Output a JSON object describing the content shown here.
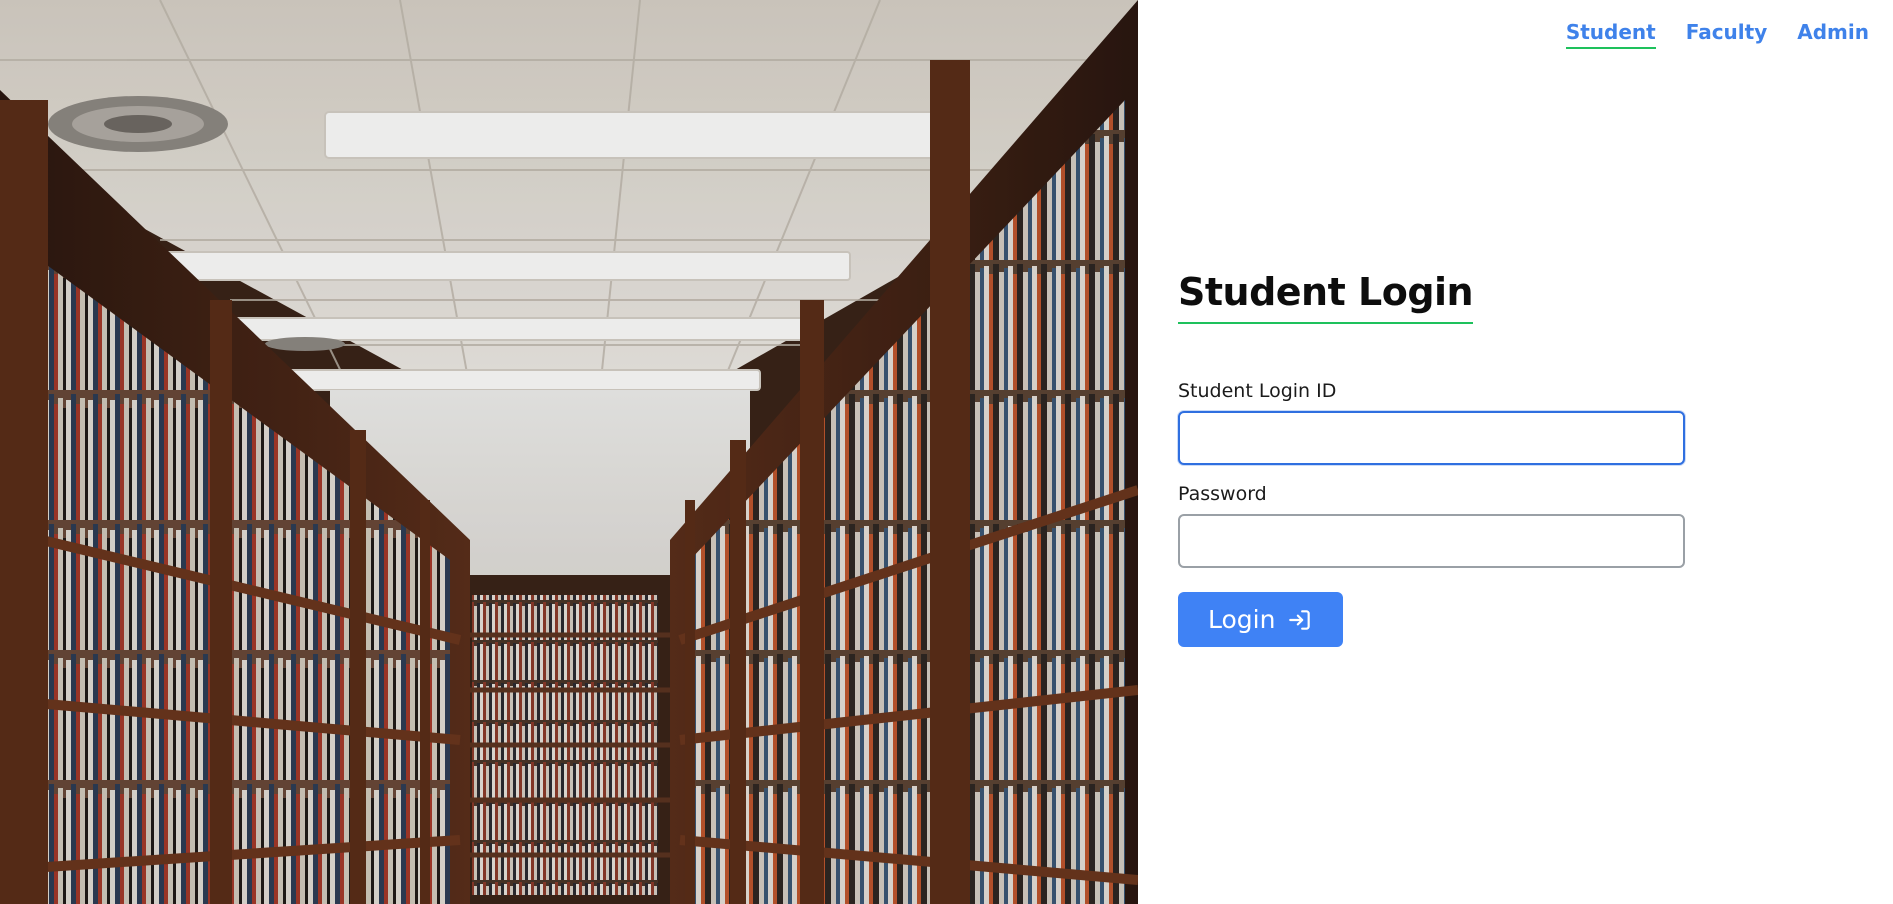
{
  "nav": {
    "items": [
      {
        "label": "Student",
        "active": true
      },
      {
        "label": "Faculty",
        "active": false
      },
      {
        "label": "Admin",
        "active": false
      }
    ]
  },
  "form": {
    "title": "Student Login",
    "login_id_label": "Student Login ID",
    "login_id_value": "",
    "password_label": "Password",
    "password_value": "",
    "submit_label": "Login",
    "submit_icon": "login-arrow-icon"
  },
  "colors": {
    "accent": "#3f82f5",
    "nav_link": "#3f82ea",
    "underline": "#1ec15c",
    "focus_border": "#2f6fe0"
  }
}
